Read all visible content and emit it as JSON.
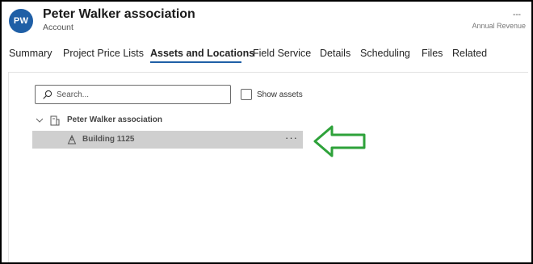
{
  "record": {
    "avatar_initials": "PW",
    "title": "Peter Walker association",
    "entity_type": "Account"
  },
  "kpi": {
    "value": "---",
    "label": "Annual Revenue"
  },
  "tabs": [
    {
      "label": "Summary"
    },
    {
      "label": "Project Price Lists"
    },
    {
      "label": "Assets and Locations",
      "active": true
    },
    {
      "label": "Field Service"
    },
    {
      "label": "Details"
    },
    {
      "label": "Scheduling"
    },
    {
      "label": "Files"
    },
    {
      "label": "Related"
    }
  ],
  "toolbar": {
    "search_placeholder": "Search...",
    "show_assets_label": "Show assets",
    "show_assets_checked": false
  },
  "tree": {
    "root": {
      "label": "Peter Walker association",
      "icon": "building-outline-icon",
      "expanded": true
    },
    "children": [
      {
        "label": "Building 1125",
        "icon": "location-pin-icon",
        "selected": true,
        "more": "···"
      }
    ]
  },
  "annotation": {
    "arrow_color": "#2ea23a",
    "icon": "arrow-left-outline"
  }
}
